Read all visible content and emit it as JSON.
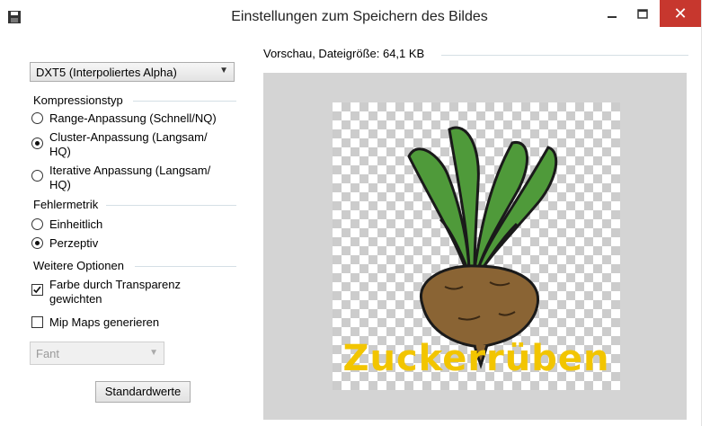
{
  "window": {
    "title": "Einstellungen zum Speichern des Bildes",
    "close_glyph": "✕",
    "icons": [
      "floppy-disk-icon",
      "minimize-icon",
      "maximize-icon",
      "close-icon"
    ]
  },
  "format": {
    "selected": "DXT5 (Interpoliertes Alpha)"
  },
  "compression": {
    "label": "Kompressionstyp",
    "options": [
      {
        "label_line1": "Range-Anpassung (Schnell/NQ)",
        "label_line2": "",
        "checked": false
      },
      {
        "label_line1": "Cluster-Anpassung (Langsam/",
        "label_line2": "HQ)",
        "checked": true
      },
      {
        "label_line1": "Iterative Anpassung (Langsam/",
        "label_line2": "HQ)",
        "checked": false
      }
    ]
  },
  "error_metric": {
    "label": "Fehlermetrik",
    "options": [
      {
        "label": "Einheitlich",
        "checked": false
      },
      {
        "label": "Perzeptiv",
        "checked": true
      }
    ]
  },
  "more_options": {
    "label": "Weitere Optionen",
    "weight_by_transparency": {
      "label_line1": "Farbe durch Transparenz",
      "label_line2": "gewichten",
      "checked": true
    },
    "generate_mipmaps": {
      "label": "Mip Maps generieren",
      "checked": false
    },
    "filter": {
      "selected": "Fant",
      "enabled": false
    }
  },
  "buttons": {
    "defaults": "Standardwerte"
  },
  "preview": {
    "label": "Vorschau, Dateigröße: 64,1 KB",
    "image_caption": "Zuckerrüben"
  },
  "colors": {
    "close_button": "#c7372e",
    "preview_background": "#d4d4d4",
    "leaf_green": "#4f9a3a",
    "beet_brown": "#8a6434",
    "caption_yellow": "#f2c500"
  }
}
